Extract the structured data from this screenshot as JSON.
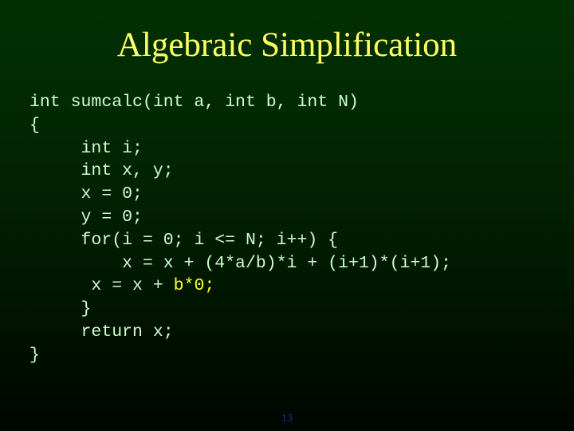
{
  "slide": {
    "title": "Algebraic Simplification",
    "code_lines": [
      {
        "indent": "",
        "text": "int sumcalc(int a, int b, int N)"
      },
      {
        "indent": "",
        "text": "{"
      },
      {
        "indent": "     ",
        "text": "int i;"
      },
      {
        "indent": "     ",
        "text": "int x, y;"
      },
      {
        "indent": "     ",
        "text": "x = 0;"
      },
      {
        "indent": "     ",
        "text": "y = 0;"
      },
      {
        "indent": "     ",
        "text": "for(i = 0; i <= N; i++) {"
      },
      {
        "indent": "         ",
        "text": "x = x + (4*a/b)*i + (i+1)*(i+1);"
      },
      {
        "indent": "      ",
        "text": "x = x + ",
        "highlight": "b*0",
        "tail": ";"
      },
      {
        "indent": "     ",
        "text": "}"
      },
      {
        "indent": "     ",
        "text": "return x;"
      },
      {
        "indent": "",
        "text": "}"
      }
    ],
    "slide_number": "13",
    "colors": {
      "title": "#ffff66",
      "code": "#ccffcc",
      "highlight": "#ffff33",
      "slide_number": "#2a2a9a"
    }
  }
}
